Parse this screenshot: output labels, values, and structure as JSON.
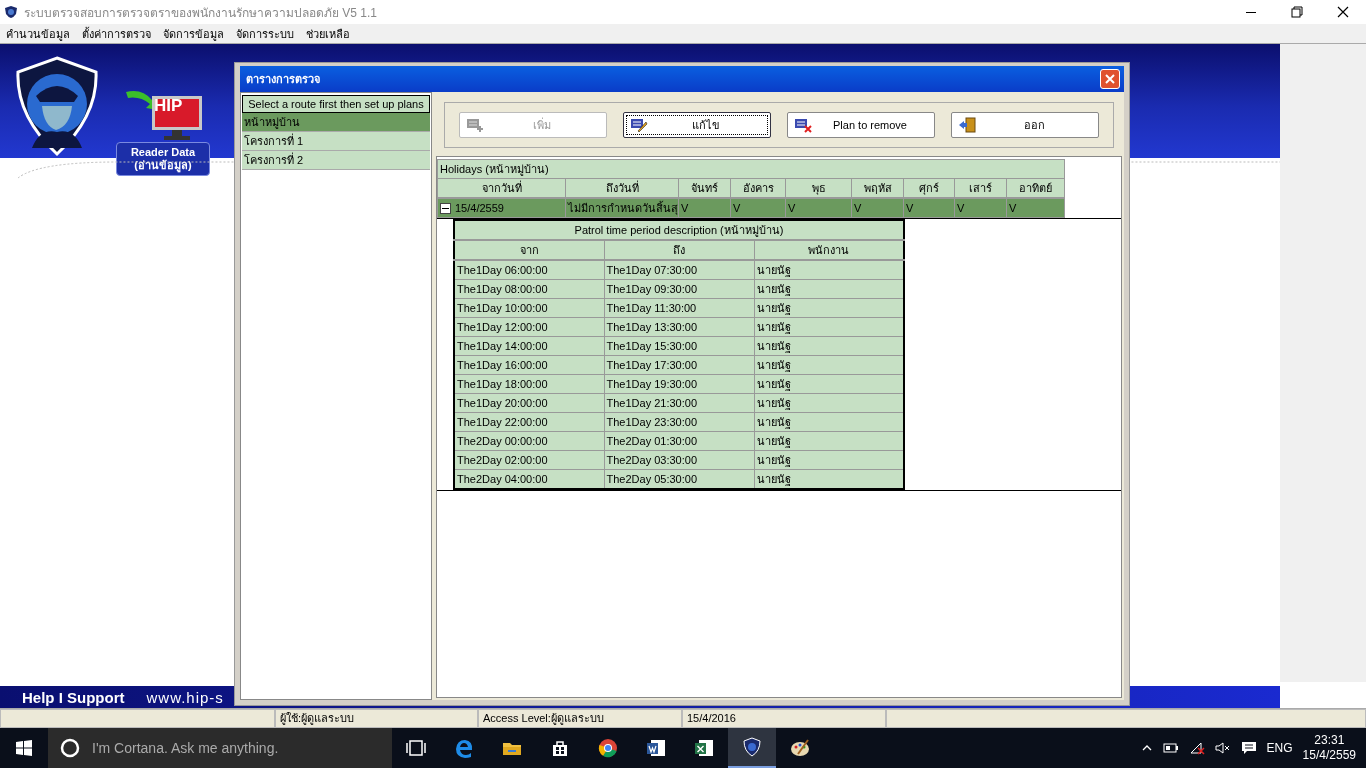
{
  "window": {
    "title": "ระบบตรวจสอบการตรวจตราของพนักงานรักษาความปลอดภัย V5 1.1"
  },
  "menu": [
    "คำนวนข้อมูล",
    "ตั้งค่าการตรวจ",
    "จัดการข้อมูล",
    "จัดการระบบ",
    "ช่วยเหลือ"
  ],
  "banner": {
    "logo_text": "HIP",
    "reader_title": "Reader Data",
    "reader_subtitle": "(อ่านข้อมูล)",
    "footer_links": "Help  I  Support",
    "footer_url": "www.hip-s"
  },
  "dialog": {
    "title": "ตารางการตรวจ",
    "routes_header": "Select a route first then set up plans",
    "routes": [
      {
        "label": "หน้าหมู่บ้าน",
        "selected": true
      },
      {
        "label": "โครงการที่ 1",
        "selected": false
      },
      {
        "label": "โครงการที่ 2",
        "selected": false
      }
    ],
    "buttons": [
      {
        "kind": "add",
        "label": "เพิ่ม",
        "disabled": true,
        "focused": false
      },
      {
        "kind": "edit",
        "label": "แก้ไข",
        "disabled": false,
        "focused": true
      },
      {
        "kind": "remove",
        "label": "Plan to remove",
        "disabled": false,
        "focused": false
      },
      {
        "kind": "exit",
        "label": "ออก",
        "disabled": false,
        "focused": false
      }
    ],
    "holidays": {
      "title": "Holidays  (หน้าหมู่บ้าน)",
      "columns": [
        "จากวันที่",
        "ถึงวันที่",
        "จันทร์",
        "อังคาร",
        "พุธ",
        "พฤหัส",
        "ศุกร์",
        "เสาร์",
        "อาทิตย์"
      ],
      "rows": [
        {
          "expanded": true,
          "cells": [
            "15/4/2559",
            "ไม่มีการกำหนดวันสิ้นสุ",
            "V",
            "V",
            "V",
            "V",
            "V",
            "V",
            "V"
          ],
          "detail": {
            "title": "Patrol time period description  (หน้าหมู่บ้าน)",
            "columns": [
              "จาก",
              "ถึง",
              "พนักงาน"
            ],
            "rows": [
              [
                "The1Day  06:00:00",
                "The1Day  07:30:00",
                "นายนัฐ"
              ],
              [
                "The1Day  08:00:00",
                "The1Day  09:30:00",
                "นายนัฐ"
              ],
              [
                "The1Day  10:00:00",
                "The1Day  11:30:00",
                "นายนัฐ"
              ],
              [
                "The1Day  12:00:00",
                "The1Day  13:30:00",
                "นายนัฐ"
              ],
              [
                "The1Day  14:00:00",
                "The1Day  15:30:00",
                "นายนัฐ"
              ],
              [
                "The1Day  16:00:00",
                "The1Day  17:30:00",
                "นายนัฐ"
              ],
              [
                "The1Day  18:00:00",
                "The1Day  19:30:00",
                "นายนัฐ"
              ],
              [
                "The1Day  20:00:00",
                "The1Day  21:30:00",
                "นายนัฐ"
              ],
              [
                "The1Day  22:00:00",
                "The1Day  23:30:00",
                "นายนัฐ"
              ],
              [
                "The2Day  00:00:00",
                "The2Day  01:30:00",
                "นายนัฐ"
              ],
              [
                "The2Day  02:00:00",
                "The2Day  03:30:00",
                "นายนัฐ"
              ],
              [
                "The2Day  04:00:00",
                "The2Day  05:30:00",
                "นายนัฐ"
              ]
            ]
          }
        }
      ]
    }
  },
  "status_bar": [
    "ผู้ใช้:ผู้ดูแลระบบ",
    "Access Level:ผู้ดูแลระบบ",
    "15/4/2016"
  ],
  "taskbar": {
    "search_placeholder": "I'm Cortana. Ask me anything.",
    "apps": [
      {
        "kind": "taskview",
        "active": false
      },
      {
        "kind": "edge",
        "active": false
      },
      {
        "kind": "explorer",
        "active": false
      },
      {
        "kind": "store",
        "active": false
      },
      {
        "kind": "chrome",
        "active": false
      },
      {
        "kind": "word",
        "active": false
      },
      {
        "kind": "excel",
        "active": false
      },
      {
        "kind": "shield",
        "active": true
      },
      {
        "kind": "paint",
        "active": false
      }
    ],
    "language": "ENG",
    "time": "23:31",
    "date": "15/4/2559"
  }
}
